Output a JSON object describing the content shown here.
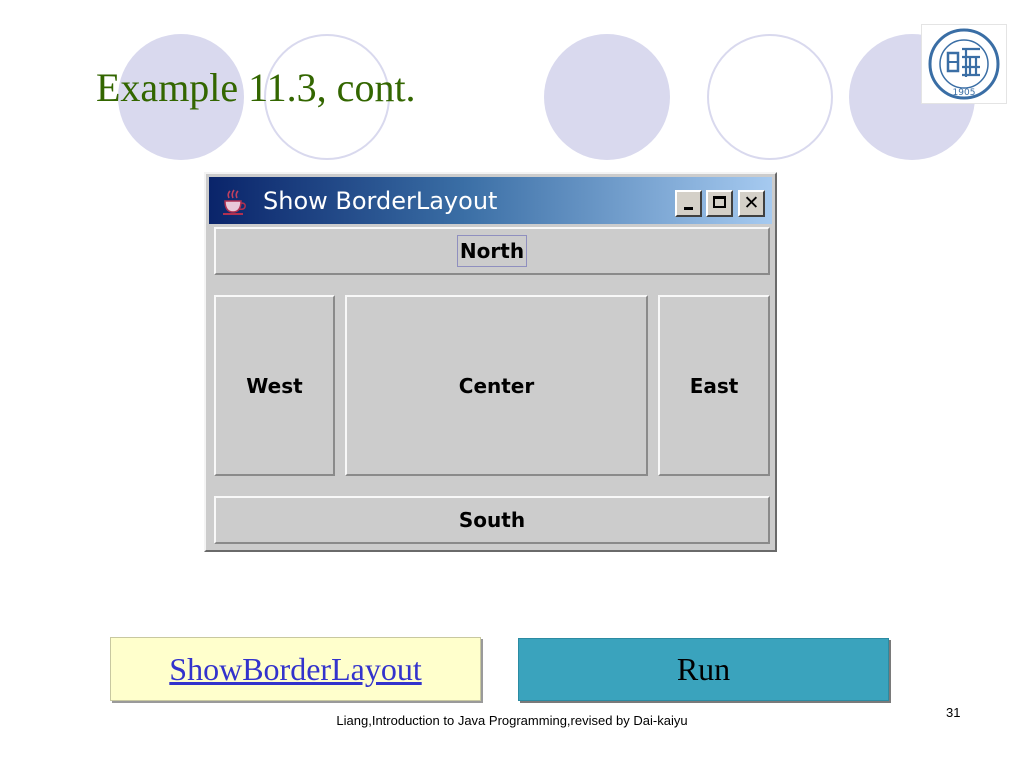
{
  "slide": {
    "title": "Example 11.3, cont.",
    "footer": "Liang,Introduction to Java Programming,revised by Dai-kaiyu",
    "page_number": "31",
    "accent_color": "#336600",
    "logo_year": "1905"
  },
  "window": {
    "title": "Show BorderLayout",
    "controls": {
      "minimize": "minimize",
      "maximize": "maximize",
      "close": "close"
    },
    "buttons": {
      "north": "North",
      "west": "West",
      "center": "Center",
      "east": "East",
      "south": "South"
    }
  },
  "links": {
    "source": "ShowBorderLayout",
    "run": "Run"
  }
}
